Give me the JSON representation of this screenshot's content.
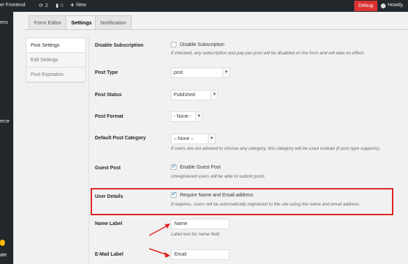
{
  "admin_bar": {
    "site_name": "er Frontend",
    "updates_count": "2",
    "comments_count": "0",
    "new_label": "New",
    "debug_label": "Debug",
    "howdy": "Howdy,"
  },
  "admin_menu": {
    "items": [
      "ens",
      "erce",
      "ate"
    ]
  },
  "tabs": [
    "Form Editor",
    "Settings",
    "Notification"
  ],
  "subnav": [
    "Post Settings",
    "Edit Settings",
    "Post Expiration"
  ],
  "fields": {
    "disable_subscription": {
      "label": "Disable Subscription",
      "checkbox_label": "Disable Subscription",
      "checked": false,
      "description": "If checked, any subscription and pay-per-post will be disabled on the form and will take no effect."
    },
    "post_type": {
      "label": "Post Type",
      "value": "post"
    },
    "post_status": {
      "label": "Post Status",
      "value": "Published"
    },
    "post_format": {
      "label": "Post Format",
      "value": "- None -"
    },
    "default_post_category": {
      "label": "Default Post Category",
      "value": "– None –",
      "description": "If users are not allowed to choose any category, this category will be used instead (if post type supports)"
    },
    "guest_post": {
      "label": "Guest Post",
      "checkbox_label": "Enable Guest Post",
      "checked": true,
      "description": "Unregistered users will be able to submit posts"
    },
    "user_details": {
      "label": "User Details",
      "checkbox_label": "Require Name and Email address",
      "checked": true,
      "description": "If requires, users will be automatically registered to the site using the name and email address"
    },
    "name_label": {
      "label": "Name Label",
      "value": "Name",
      "description": "Label text for name field"
    },
    "email_label": {
      "label": "E-Mail Label",
      "value": "Email"
    }
  },
  "colors": {
    "admin_bar": "#23282d",
    "debug": "#dc3232",
    "annotation": "#e02020",
    "checkbox_check": "#1e8cbe"
  }
}
